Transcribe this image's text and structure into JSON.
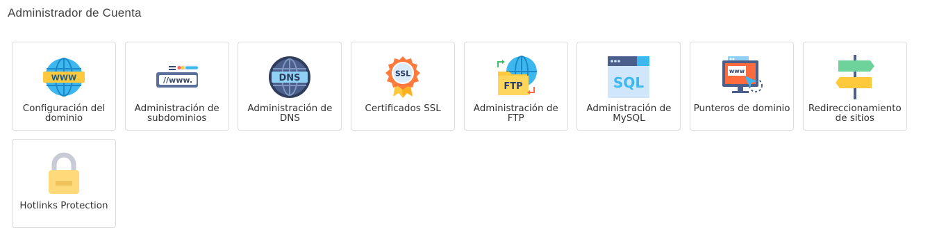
{
  "section": {
    "title": "Administrador de Cuenta"
  },
  "tiles": [
    {
      "label": "Configuración del dominio",
      "icon": "www-globe-icon"
    },
    {
      "label": "Administración de subdominios",
      "icon": "subdomain-www-icon"
    },
    {
      "label": "Administración de DNS",
      "icon": "dns-globe-icon"
    },
    {
      "label": "Certificados SSL",
      "icon": "ssl-badge-icon"
    },
    {
      "label": "Administración de FTP",
      "icon": "ftp-folder-icon"
    },
    {
      "label": "Administración de MySQL",
      "icon": "sql-database-icon"
    },
    {
      "label": "Punteros de dominio",
      "icon": "domain-pointer-monitor-icon"
    },
    {
      "label": "Redireccionamiento de sitios",
      "icon": "signpost-icon"
    },
    {
      "label": "Hotlinks Protection",
      "icon": "padlock-icon"
    }
  ],
  "icon_text": {
    "www": "WWW",
    "sub": "//www.",
    "dns": "DNS",
    "ssl": "SSL",
    "ftp": "FTP",
    "sql": "SQL",
    "monitor": "www"
  }
}
